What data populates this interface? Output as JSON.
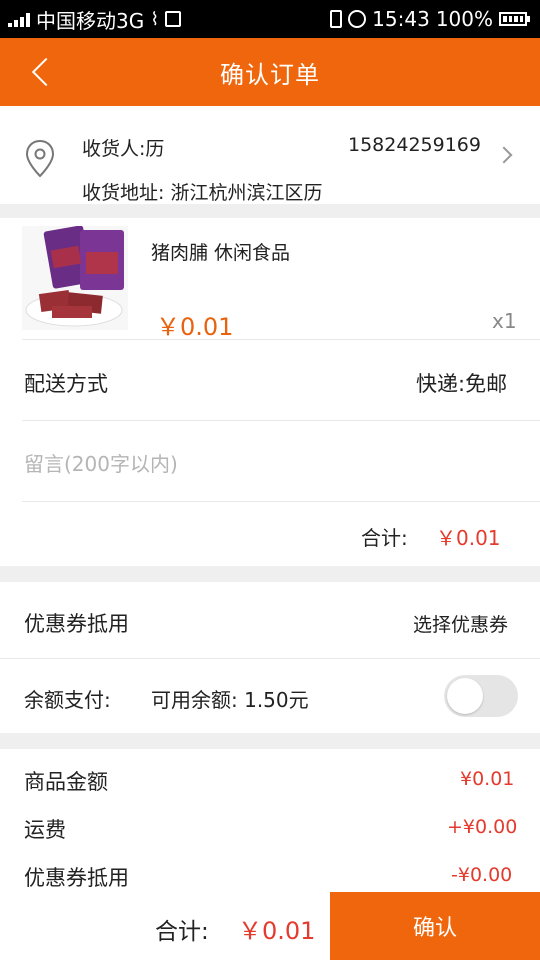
{
  "status_bar": {
    "carrier": "中国移动3G",
    "time": "15:43",
    "battery": "100%"
  },
  "header": {
    "title": "确认订单"
  },
  "address": {
    "receiver": "收货人:历",
    "phone": "15824259169",
    "address": "收货地址:  浙江杭州滨江区历"
  },
  "product": {
    "name": "猪肉脯 休闲食品",
    "price": "￥0.01",
    "quantity": "x1"
  },
  "delivery": {
    "label": "配送方式",
    "value": "快递:免邮"
  },
  "message": {
    "placeholder": "留言(200字以内)"
  },
  "subtotal": {
    "label": "合计:",
    "value": "￥0.01"
  },
  "coupon": {
    "label": "优惠券抵用",
    "action": "选择优惠券"
  },
  "balance": {
    "label": "余额支付:",
    "available": "可用余额:  1.50元",
    "enabled": false
  },
  "summary": [
    {
      "label": "商品金额",
      "value": "¥0.01"
    },
    {
      "label": "运费",
      "value": "+¥0.00"
    },
    {
      "label": "优惠券抵用",
      "value": "-¥0.00"
    }
  ],
  "footer": {
    "total_label": "合计:",
    "total_value": "￥0.01",
    "confirm": "确认"
  },
  "colors": {
    "accent": "#f0660c",
    "price": "#e53b2e"
  }
}
